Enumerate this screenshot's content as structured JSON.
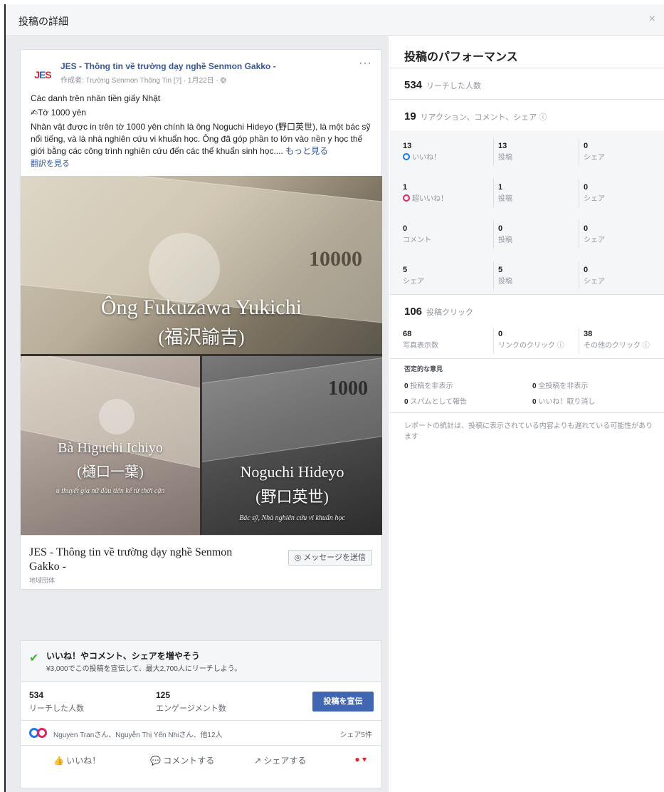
{
  "modal": {
    "title": "投稿の詳細",
    "close_label": "×"
  },
  "post": {
    "page_name": "JES - Thông tin về trường dạy nghề Senmon Gakko -",
    "logo_text_a": "J",
    "logo_text_b": "E",
    "logo_text_c": "S",
    "meta": "作成者: Trường Senmon Thông Tin [?] · 1月22日 · ❂",
    "more_label": "···",
    "line1": "Các danh trên nhân tiền giấy Nhật",
    "line2": "✍Tờ 1000 yên",
    "body": "Nhân vật được in trên tờ 1000 yên chính là ông Noguchi Hideyo (野口英世), là một bác sỹ nổi tiếng, và là nhà nghiên cứu vi khuẩn học. Ông đã góp phần to lớn vào nền y học thế giới bằng các công trình nghiên cứu đến các thể khuẩn sinh học....",
    "see_more": "もっと見る",
    "translate": "翻訳を見る",
    "photos": {
      "big_denom": "10000",
      "big_caption_1": "Ông Fukuzawa Yukichi",
      "big_caption_2": "(福沢諭吉)",
      "bl_caption_1": "Bà Higuchi Ichiyo",
      "bl_caption_2": "(樋口一葉)",
      "bl_caption_3": "u thuyết gia nữ đầu tiên kể từ thời cận",
      "br_denom": "1000",
      "br_caption_1": "Noguchi Hideyo",
      "br_caption_2": "(野口英世)",
      "br_caption_3": "Bác sỹ, Nhà nghiên cứu vi khuẩn học"
    },
    "link_title": "JES - Thông tin về trường dạy nghề Senmon Gakko -",
    "link_sub": "地域団体",
    "message_button": "◎ メッセージを送信"
  },
  "boost": {
    "title": "いいね！やコメント、シェアを増やそう",
    "desc": "¥3,000でこの投稿を宣伝して、最大2,700人にリーチしよう。",
    "reach_num": "534",
    "reach_label": "リーチした人数",
    "engage_num": "125",
    "engage_label": "エンゲージメント数",
    "button": "投稿を宣伝"
  },
  "reactions": {
    "names": "Nguyen Tranさん、Nguyễn Thị Yến Nhiさん、他12人",
    "shares": "シェア5件"
  },
  "actions": {
    "like": "👍 いいね！",
    "comment": "💬 コメントする",
    "share": "↗ シェアする",
    "more": "● ▾"
  },
  "performance": {
    "title": "投稿のパフォーマンス",
    "reach_num": "534",
    "reach_label": "リーチした人数",
    "reactions_num": "19",
    "reactions_label": "リアクション、コメント、シェア ⓘ",
    "grid": [
      [
        {
          "n": "13",
          "l": "いいね！"
        },
        {
          "n": "13",
          "l": "投稿"
        },
        {
          "n": "0",
          "l": "シェア"
        }
      ],
      [
        {
          "n": "1",
          "l": "超いいね！"
        },
        {
          "n": "1",
          "l": "投稿"
        },
        {
          "n": "0",
          "l": "シェア"
        }
      ],
      [
        {
          "n": "0",
          "l": "コメント"
        },
        {
          "n": "0",
          "l": "投稿"
        },
        {
          "n": "0",
          "l": "シェア"
        }
      ],
      [
        {
          "n": "5",
          "l": "シェア"
        },
        {
          "n": "5",
          "l": "投稿"
        },
        {
          "n": "0",
          "l": "シェア"
        }
      ]
    ],
    "clicks_num": "106",
    "clicks_label": "投稿クリック",
    "clicks": [
      {
        "n": "68",
        "l": "写真表示数"
      },
      {
        "n": "0",
        "l": "リンクのクリック ⓘ"
      },
      {
        "n": "38",
        "l": "その他のクリック ⓘ"
      }
    ],
    "negative_title": "否定的な意見",
    "negative": [
      {
        "n": "0",
        "l": "投稿を非表示"
      },
      {
        "n": "0",
        "l": "全投稿を非表示"
      },
      {
        "n": "0",
        "l": "スパムとして報告"
      },
      {
        "n": "0",
        "l": "いいね！取り消し"
      }
    ],
    "note": "レポートの統計は、投稿に表示されている内容よりも遅れている可能性があります"
  }
}
